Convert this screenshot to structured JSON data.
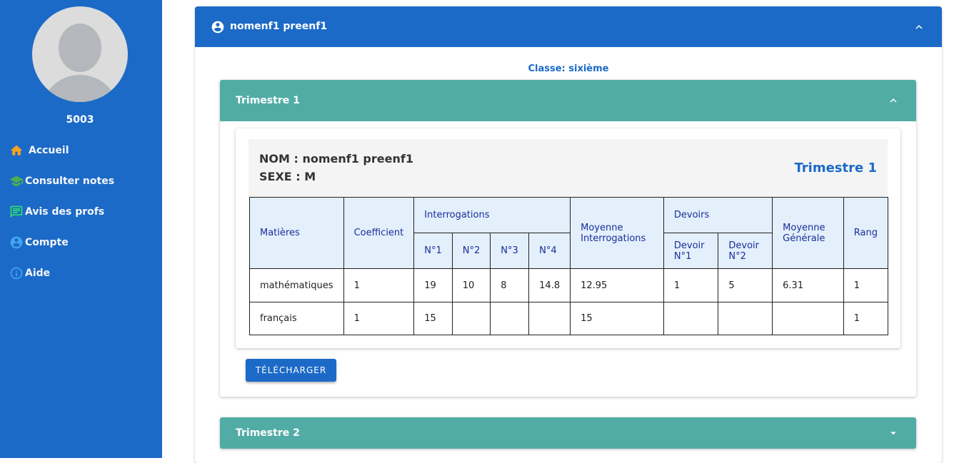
{
  "sidebar": {
    "user_id": "5003",
    "items": [
      {
        "label": "Accueil",
        "icon": "home-icon",
        "color": "#f6a21e"
      },
      {
        "label": "Consulter notes",
        "icon": "graduation-cap-icon",
        "color": "#4caf50"
      },
      {
        "label": "Avis des profs",
        "icon": "comment-icon",
        "color": "#2ee06a"
      },
      {
        "label": "Compte",
        "icon": "account-circle-icon",
        "color": "#42a5f5"
      },
      {
        "label": "Aide",
        "icon": "info-icon",
        "color": "#42a5f5"
      }
    ]
  },
  "student": {
    "header_name": "nomenf1 preenf1",
    "classe": "Classe: sixième",
    "nom_line": "NOM : nomenf1 preenf1",
    "sexe_line": "SEXE : M"
  },
  "trimestre1": {
    "label": "Trimestre 1",
    "title_right": "Trimestre 1",
    "columns": {
      "matieres": "Matières",
      "coefficient": "Coefficient",
      "interrogations": "Interrogations",
      "n1": "N°1",
      "n2": "N°2",
      "n3": "N°3",
      "n4": "N°4",
      "moyenne_interrogations_1": "Moyenne",
      "moyenne_interrogations_2": "Interrogations",
      "devoirs": "Devoirs",
      "devoir1_a": "Devoir",
      "devoir1_b": "N°1",
      "devoir2_a": "Devoir",
      "devoir2_b": "N°2",
      "moyenne_generale_1": "Moyenne",
      "moyenne_generale_2": "Générale",
      "rang": "Rang"
    },
    "rows": [
      [
        "mathématiques",
        "1",
        "19",
        "10",
        "8",
        "14.8",
        "12.95",
        "1",
        "5",
        "6.31",
        "1"
      ],
      [
        "français",
        "1",
        "15",
        "",
        "",
        "",
        "15",
        "",
        "",
        "",
        "1"
      ]
    ],
    "download_label": "TÉLÉCHARGER"
  },
  "trimestre2": {
    "label": "Trimestre 2"
  },
  "colors": {
    "primary": "#1c6ac7",
    "teal": "#52aca6",
    "header_bg": "#e3effb",
    "header_text": "#1a2e99"
  }
}
